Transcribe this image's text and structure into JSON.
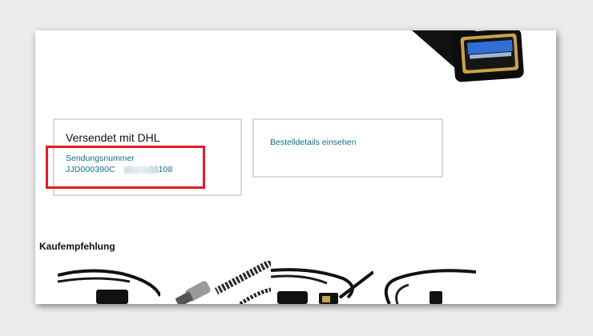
{
  "shipping": {
    "title": "Versendet mit DHL",
    "tracking_label": "Sendungsnummer",
    "tracking_prefix": "JJD000390C",
    "tracking_suffix": "66108"
  },
  "order": {
    "details_link": "Bestelldetails einsehen"
  },
  "recommendations": {
    "title": "Kaufempfehlung",
    "items": [
      {
        "icon": "usb-cable-image"
      },
      {
        "icon": "braided-cable-image"
      },
      {
        "icon": "usb-adapter-cable-image"
      },
      {
        "icon": "cable-image"
      }
    ]
  },
  "colors": {
    "highlight": "#e11d24",
    "link": "#0f7085",
    "usb_blue": "#2f6fd6"
  }
}
